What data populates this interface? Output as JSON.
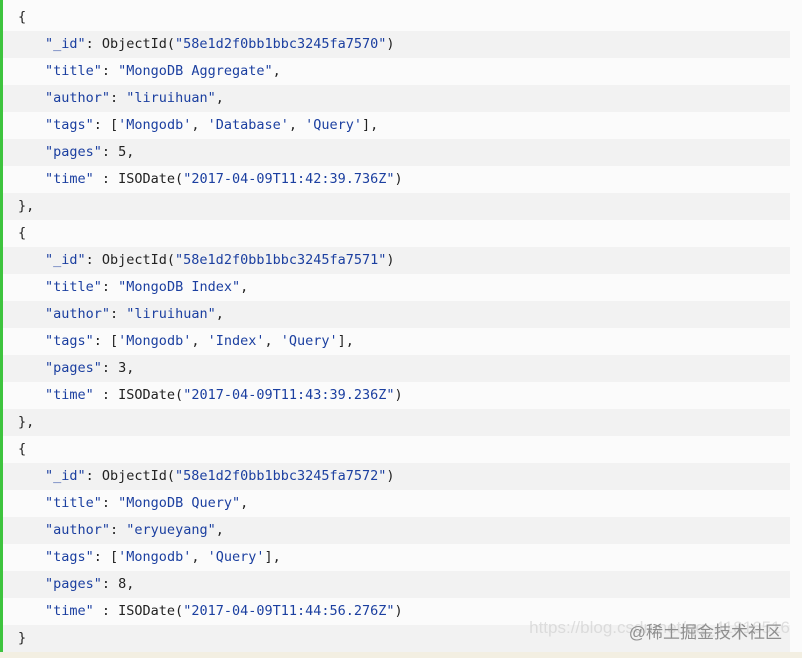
{
  "lines": [
    {
      "indent": 0,
      "segs": [
        {
          "t": "{",
          "c": "p"
        }
      ]
    },
    {
      "indent": 1,
      "segs": [
        {
          "t": "\"_id\"",
          "c": "s"
        },
        {
          "t": ": ObjectId(",
          "c": "p"
        },
        {
          "t": "\"58e1d2f0bb1bbc3245fa7570\"",
          "c": "s"
        },
        {
          "t": ")",
          "c": "p"
        }
      ]
    },
    {
      "indent": 1,
      "segs": [
        {
          "t": "\"title\"",
          "c": "s"
        },
        {
          "t": ": ",
          "c": "p"
        },
        {
          "t": "\"MongoDB Aggregate\"",
          "c": "s"
        },
        {
          "t": ",",
          "c": "p"
        }
      ]
    },
    {
      "indent": 1,
      "segs": [
        {
          "t": "\"author\"",
          "c": "s"
        },
        {
          "t": ": ",
          "c": "p"
        },
        {
          "t": "\"liruihuan\"",
          "c": "s"
        },
        {
          "t": ",",
          "c": "p"
        }
      ]
    },
    {
      "indent": 1,
      "segs": [
        {
          "t": "\"tags\"",
          "c": "s"
        },
        {
          "t": ": [",
          "c": "p"
        },
        {
          "t": "'Mongodb'",
          "c": "s"
        },
        {
          "t": ", ",
          "c": "p"
        },
        {
          "t": "'Database'",
          "c": "s"
        },
        {
          "t": ", ",
          "c": "p"
        },
        {
          "t": "'Query'",
          "c": "s"
        },
        {
          "t": "],",
          "c": "p"
        }
      ]
    },
    {
      "indent": 1,
      "segs": [
        {
          "t": "\"pages\"",
          "c": "s"
        },
        {
          "t": ": 5,",
          "c": "p"
        }
      ]
    },
    {
      "indent": 1,
      "segs": [
        {
          "t": "\"time\"",
          "c": "s"
        },
        {
          "t": " : ISODate(",
          "c": "p"
        },
        {
          "t": "\"2017-04-09T11:42:39.736Z\"",
          "c": "s"
        },
        {
          "t": ")",
          "c": "p"
        }
      ]
    },
    {
      "indent": 0,
      "segs": [
        {
          "t": "},",
          "c": "p"
        }
      ]
    },
    {
      "indent": 0,
      "segs": [
        {
          "t": "{",
          "c": "p"
        }
      ]
    },
    {
      "indent": 1,
      "segs": [
        {
          "t": "\"_id\"",
          "c": "s"
        },
        {
          "t": ": ObjectId(",
          "c": "p"
        },
        {
          "t": "\"58e1d2f0bb1bbc3245fa7571\"",
          "c": "s"
        },
        {
          "t": ")",
          "c": "p"
        }
      ]
    },
    {
      "indent": 1,
      "segs": [
        {
          "t": "\"title\"",
          "c": "s"
        },
        {
          "t": ": ",
          "c": "p"
        },
        {
          "t": "\"MongoDB Index\"",
          "c": "s"
        },
        {
          "t": ",",
          "c": "p"
        }
      ]
    },
    {
      "indent": 1,
      "segs": [
        {
          "t": "\"author\"",
          "c": "s"
        },
        {
          "t": ": ",
          "c": "p"
        },
        {
          "t": "\"liruihuan\"",
          "c": "s"
        },
        {
          "t": ",",
          "c": "p"
        }
      ]
    },
    {
      "indent": 1,
      "segs": [
        {
          "t": "\"tags\"",
          "c": "s"
        },
        {
          "t": ": [",
          "c": "p"
        },
        {
          "t": "'Mongodb'",
          "c": "s"
        },
        {
          "t": ", ",
          "c": "p"
        },
        {
          "t": "'Index'",
          "c": "s"
        },
        {
          "t": ", ",
          "c": "p"
        },
        {
          "t": "'Query'",
          "c": "s"
        },
        {
          "t": "],",
          "c": "p"
        }
      ]
    },
    {
      "indent": 1,
      "segs": [
        {
          "t": "\"pages\"",
          "c": "s"
        },
        {
          "t": ": 3,",
          "c": "p"
        }
      ]
    },
    {
      "indent": 1,
      "segs": [
        {
          "t": "\"time\"",
          "c": "s"
        },
        {
          "t": " : ISODate(",
          "c": "p"
        },
        {
          "t": "\"2017-04-09T11:43:39.236Z\"",
          "c": "s"
        },
        {
          "t": ")",
          "c": "p"
        }
      ]
    },
    {
      "indent": 0,
      "segs": [
        {
          "t": "},",
          "c": "p"
        }
      ]
    },
    {
      "indent": 0,
      "segs": [
        {
          "t": "{",
          "c": "p"
        }
      ]
    },
    {
      "indent": 1,
      "segs": [
        {
          "t": "\"_id\"",
          "c": "s"
        },
        {
          "t": ": ObjectId(",
          "c": "p"
        },
        {
          "t": "\"58e1d2f0bb1bbc3245fa7572\"",
          "c": "s"
        },
        {
          "t": ")",
          "c": "p"
        }
      ]
    },
    {
      "indent": 1,
      "segs": [
        {
          "t": "\"title\"",
          "c": "s"
        },
        {
          "t": ": ",
          "c": "p"
        },
        {
          "t": "\"MongoDB Query\"",
          "c": "s"
        },
        {
          "t": ",",
          "c": "p"
        }
      ]
    },
    {
      "indent": 1,
      "segs": [
        {
          "t": "\"author\"",
          "c": "s"
        },
        {
          "t": ": ",
          "c": "p"
        },
        {
          "t": "\"eryueyang\"",
          "c": "s"
        },
        {
          "t": ",",
          "c": "p"
        }
      ]
    },
    {
      "indent": 1,
      "segs": [
        {
          "t": "\"tags\"",
          "c": "s"
        },
        {
          "t": ": [",
          "c": "p"
        },
        {
          "t": "'Mongodb'",
          "c": "s"
        },
        {
          "t": ", ",
          "c": "p"
        },
        {
          "t": "'Query'",
          "c": "s"
        },
        {
          "t": "],",
          "c": "p"
        }
      ]
    },
    {
      "indent": 1,
      "segs": [
        {
          "t": "\"pages\"",
          "c": "s"
        },
        {
          "t": ": 8,",
          "c": "p"
        }
      ]
    },
    {
      "indent": 1,
      "segs": [
        {
          "t": "\"time\"",
          "c": "s"
        },
        {
          "t": " : ISODate(",
          "c": "p"
        },
        {
          "t": "\"2017-04-09T11:44:56.276Z\"",
          "c": "s"
        },
        {
          "t": ")",
          "c": "p"
        }
      ]
    },
    {
      "indent": 0,
      "segs": [
        {
          "t": "}",
          "c": "p"
        }
      ]
    }
  ],
  "watermark": {
    "url": "https://blog.csdn.net/qq_41816516",
    "brand": "@稀土掘金技术社区"
  },
  "colors": {
    "accent_border": "#3ec43e",
    "string": "#1b3fa0",
    "plain": "#222222",
    "row_shade": "#f2f2f2"
  }
}
